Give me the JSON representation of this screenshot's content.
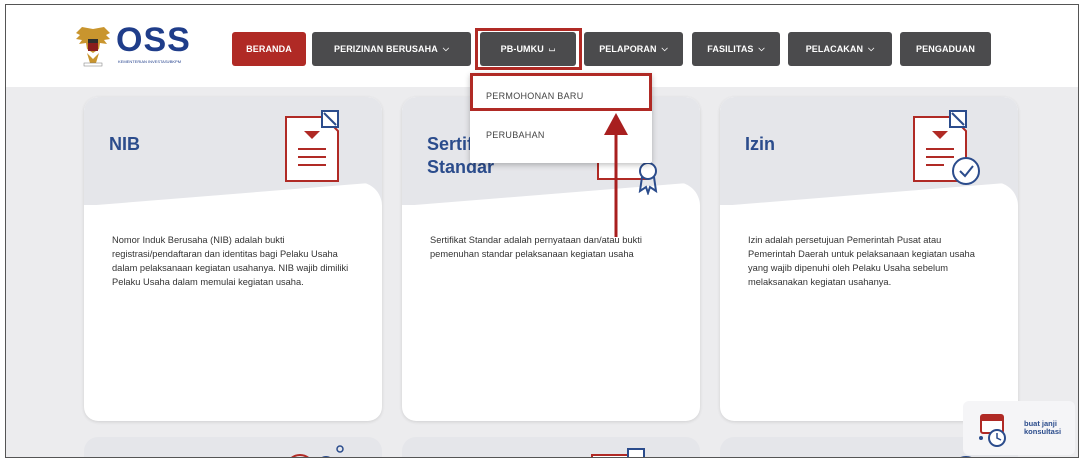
{
  "brand": {
    "name": "OSS",
    "subtitle": "KEMENTERIAN INVESTASI/BKPM"
  },
  "nav": {
    "beranda": "BERANDA",
    "perizinan": "PERIZINAN BERUSAHA",
    "pb_umku": "PB-UMKU",
    "pelaporan": "PELAPORAN",
    "fasilitas": "FASILITAS",
    "pelacakan": "PELACAKAN",
    "pengaduan": "PENGADUAN"
  },
  "dropdown": {
    "items": [
      "PERMOHONAN BARU",
      "PERUBAHAN"
    ]
  },
  "cards": [
    {
      "title": "NIB",
      "description": "Nomor Induk Berusaha (NIB) adalah bukti registrasi/pendaftaran dan identitas bagi Pelaku Usaha dalam pelaksanaan kegiatan usahanya. NIB wajib dimiliki Pelaku Usaha dalam memulai kegiatan usaha."
    },
    {
      "title_line1": "Sertif",
      "title_line2": "Standar",
      "description": "Sertifikat Standar adalah pernyataan dan/atau bukti pemenuhan standar pelaksanaan kegiatan usaha"
    },
    {
      "title": "Izin",
      "description": "Izin adalah persetujuan Pemerintah Pusat atau Pemerintah Daerah untuk pelaksanaan kegiatan usaha yang wajib dipenuhi oleh Pelaku Usaha sebelum melaksanakan kegiatan usahanya."
    }
  ],
  "consult": {
    "label": "buat janji konsultasi"
  },
  "colors": {
    "accent_red": "#b02a25",
    "nav_grey": "#4b4b4d",
    "title_blue": "#2b4c8c"
  }
}
